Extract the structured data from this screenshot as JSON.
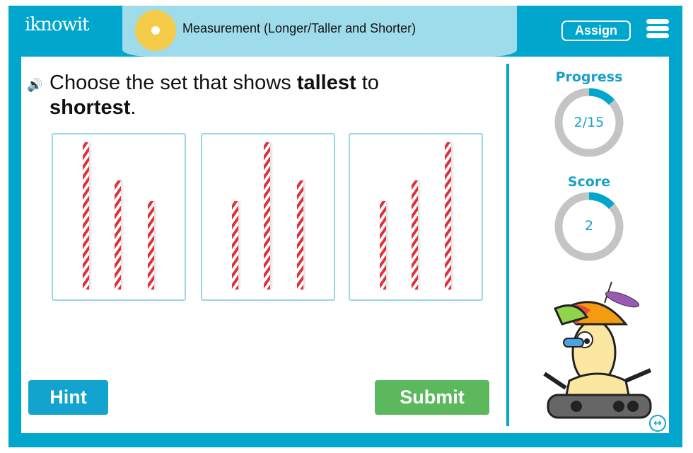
{
  "header": {
    "logo": "iknowit",
    "title": "Measurement (Longer/Taller and Shorter)",
    "assign_label": "Assign",
    "menu_icon": "hamburger-icon"
  },
  "question": {
    "prefix": "Choose the set that shows ",
    "bold1": "tallest",
    "middle": " to ",
    "bold2": "shortest",
    "suffix": "."
  },
  "options": [
    {
      "straw_heights": [
        1.0,
        0.74,
        0.6
      ]
    },
    {
      "straw_heights": [
        0.6,
        1.0,
        0.74
      ]
    },
    {
      "straw_heights": [
        0.6,
        0.74,
        1.0
      ]
    }
  ],
  "progress": {
    "label": "Progress",
    "text": "2/15",
    "fraction": 0.1333
  },
  "score": {
    "label": "Score",
    "text": "2",
    "fraction": 0.1333
  },
  "buttons": {
    "hint": "Hint",
    "submit": "Submit"
  },
  "colors": {
    "brand": "#00a6cc",
    "submit": "#5cb85c",
    "ring_track": "#c4c4c4"
  }
}
